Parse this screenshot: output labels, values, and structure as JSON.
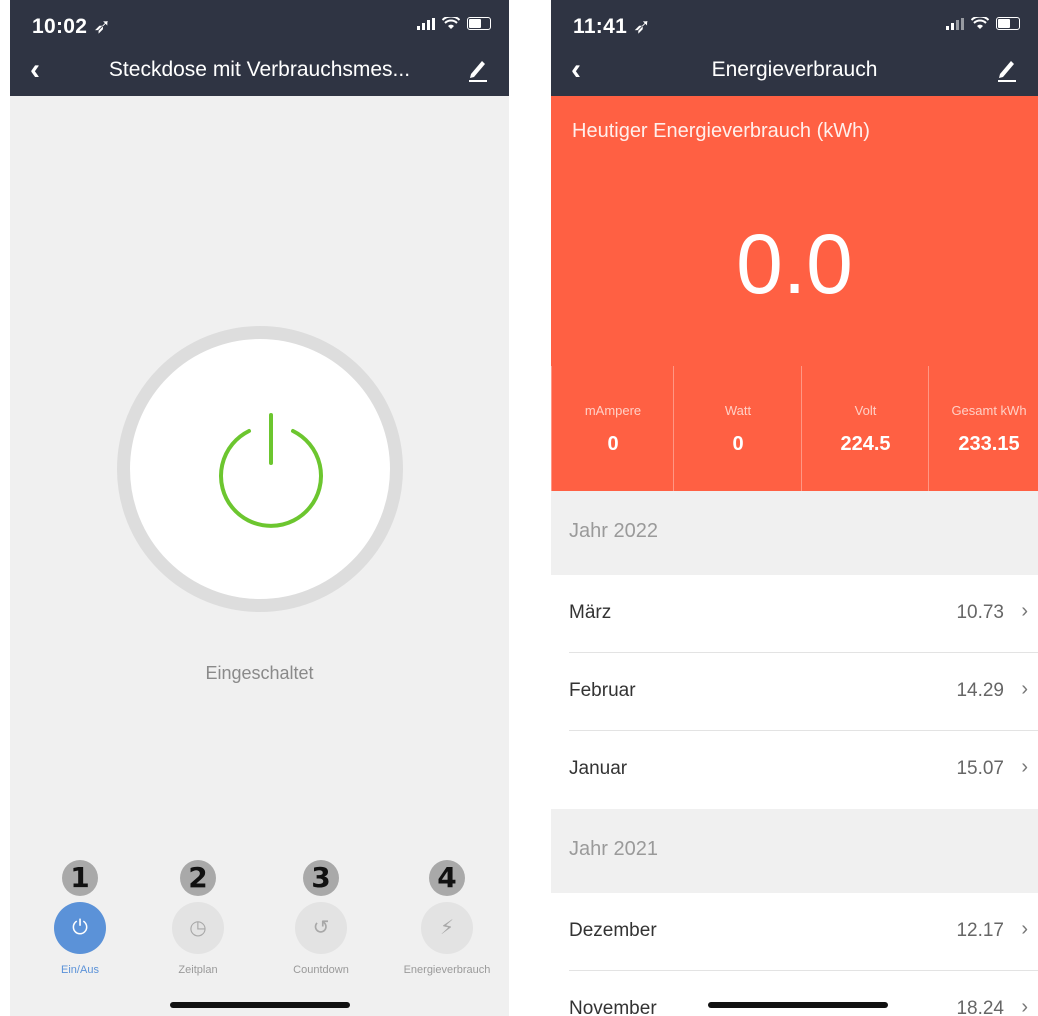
{
  "left": {
    "status": {
      "time": "10:02 ➶"
    },
    "nav": {
      "back": "‹",
      "title": "Steckdose mit Verbrauchsmes..."
    },
    "state": "Eingeschaltet",
    "tabs": [
      {
        "num": "1",
        "icon": "⏻",
        "label": "Ein/Aus",
        "active": true
      },
      {
        "num": "2",
        "icon": "◷",
        "label": "Zeitplan",
        "active": false
      },
      {
        "num": "3",
        "icon": "↺",
        "label": "Countdown",
        "active": false
      },
      {
        "num": "4",
        "icon": "⚡",
        "label": "Energieverbrauch",
        "active": false
      }
    ]
  },
  "right": {
    "status": {
      "time": "11:41 ➶"
    },
    "nav": {
      "back": "‹",
      "title": "Energieverbrauch"
    },
    "hero": {
      "title": "Heutiger Energieverbrauch (kWh)",
      "value": "0.0",
      "stats": [
        {
          "label": "mAmpere",
          "value": "0"
        },
        {
          "label": "Watt",
          "value": "0"
        },
        {
          "label": "Volt",
          "value": "224.5"
        },
        {
          "label": "Gesamt kWh",
          "value": "233.15"
        }
      ]
    },
    "years": [
      {
        "year": "Jahr 2022",
        "months": [
          {
            "name": "März",
            "kwh": "10.73"
          },
          {
            "name": "Februar",
            "kwh": "14.29"
          },
          {
            "name": "Januar",
            "kwh": "15.07"
          }
        ]
      },
      {
        "year": "Jahr 2021",
        "months": [
          {
            "name": "Dezember",
            "kwh": "12.17"
          },
          {
            "name": "November",
            "kwh": "18.24"
          }
        ]
      }
    ],
    "chevron": "›"
  },
  "colors": {
    "navbar": "#2f3443",
    "accent_orange": "#ff6043",
    "power_green": "#6cc62f",
    "active_blue": "#5b92d8"
  }
}
